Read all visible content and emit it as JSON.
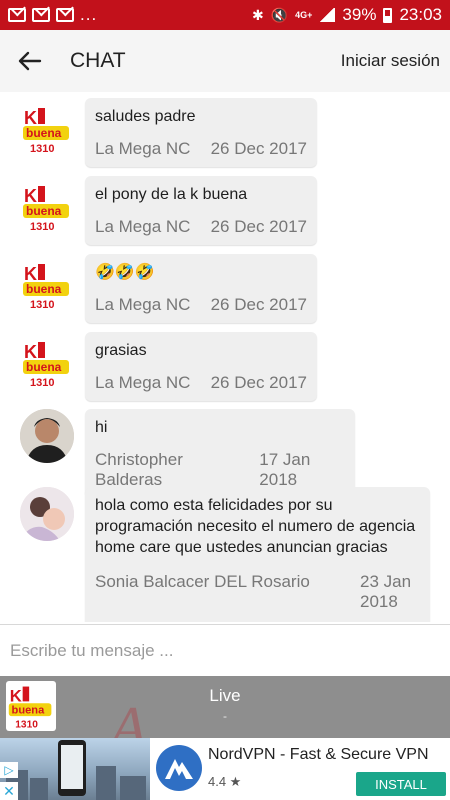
{
  "status_bar": {
    "dots": "...",
    "network": "4G+",
    "battery": "39%",
    "time": "23:03"
  },
  "header": {
    "title": "CHAT",
    "login": "Iniciar sesión"
  },
  "messages": [
    {
      "text": "saludes padre",
      "author": "La Mega NC",
      "date": "26 Dec 2017",
      "avatar": "station-logo"
    },
    {
      "text": "el pony de la k buena",
      "author": "La Mega NC",
      "date": "26 Dec 2017",
      "avatar": "station-logo"
    },
    {
      "text": "🤣🤣🤣",
      "author": "La Mega NC",
      "date": "26 Dec 2017",
      "avatar": "station-logo"
    },
    {
      "text": "grasias",
      "author": "La Mega NC",
      "date": "26 Dec 2017",
      "avatar": "station-logo"
    },
    {
      "text": "hi",
      "author": "Christopher Balderas",
      "date": "17 Jan 2018",
      "avatar": "user-photo"
    },
    {
      "text": "hola como esta felicidades por su programación necesito el numero de agencia home care que ustedes anuncian gracias",
      "author": "Sonia Balcacer DEL Rosario",
      "date": "23 Jan 2018",
      "avatar": "user-photo"
    }
  ],
  "input": {
    "placeholder": "Escribe tu mensaje ..."
  },
  "player": {
    "label": "Live",
    "sub": "-"
  },
  "ad": {
    "title": "NordVPN - Fast & Secure VPN",
    "rating": "4.4 ★",
    "install": "INSTALL"
  },
  "colors": {
    "status_bar": "#c2111b",
    "install": "#1aa68a"
  }
}
